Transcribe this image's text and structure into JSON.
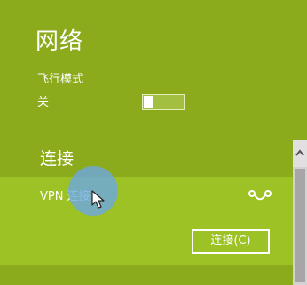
{
  "panel": {
    "title": "网络"
  },
  "airplane_mode": {
    "label": "飞行模式",
    "state": "关",
    "enabled": false
  },
  "connections": {
    "heading": "连接",
    "items": [
      {
        "name": "VPN 连接",
        "icon": "vpn-icon",
        "button_label": "连接(C)"
      }
    ]
  },
  "icons": {
    "vpn": "vpn-icon",
    "scroll_up": "chevron-up-icon",
    "cursor": "mouse-pointer-icon"
  },
  "colors": {
    "panel_background": "#8cab1c",
    "selected_item_background": "#9dc225",
    "text": "#ffffff",
    "scrollbar_track": "#d2d2d2",
    "scrollbar_thumb": "#a6a6a6",
    "cursor_highlight": "#6ba6e8"
  }
}
